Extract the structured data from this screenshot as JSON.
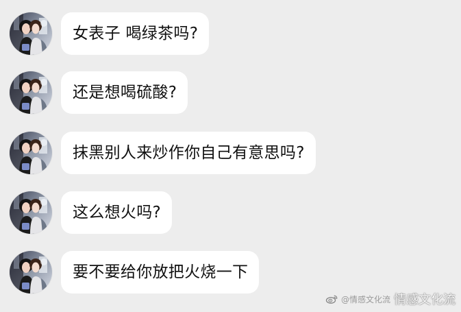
{
  "messages": [
    {
      "text": "女表子 喝绿茶吗?"
    },
    {
      "text": "还是想喝硫酸?"
    },
    {
      "text": "抹黑别人来炒作你自己有意思吗?"
    },
    {
      "text": "这么想火吗?"
    },
    {
      "text": "要不要给你放把火烧一下"
    }
  ],
  "watermark": {
    "handle": "@情感文化流",
    "text": "情感文化流"
  },
  "avatar": {
    "icon": "profile-photo-icon"
  },
  "colors": {
    "background": "#ededed",
    "bubble": "#ffffff",
    "text": "#111111"
  }
}
